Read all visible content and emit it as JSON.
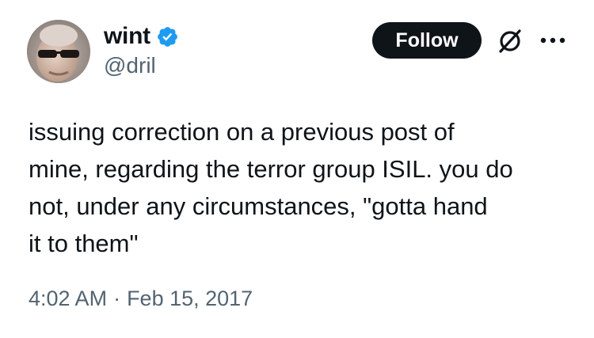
{
  "author": {
    "display_name": "wint",
    "handle": "@dril",
    "verified": true,
    "verified_color": "#1d9bf0"
  },
  "actions": {
    "follow_label": "Follow",
    "grok_icon": "slashed-circle-icon",
    "more_icon": "more-horizontal-icon"
  },
  "tweet": {
    "text": "issuing correction on a previous post of\nmine, regarding the terror group ISIL. you do\nnot, under any circumstances, \"gotta hand\nit to them\""
  },
  "meta": {
    "time": "4:02 AM",
    "separator": "·",
    "date": "Feb 15, 2017"
  },
  "colors": {
    "text_primary": "#0f1419",
    "text_secondary": "#536471",
    "button_bg": "#0f1419",
    "button_text": "#ffffff"
  }
}
